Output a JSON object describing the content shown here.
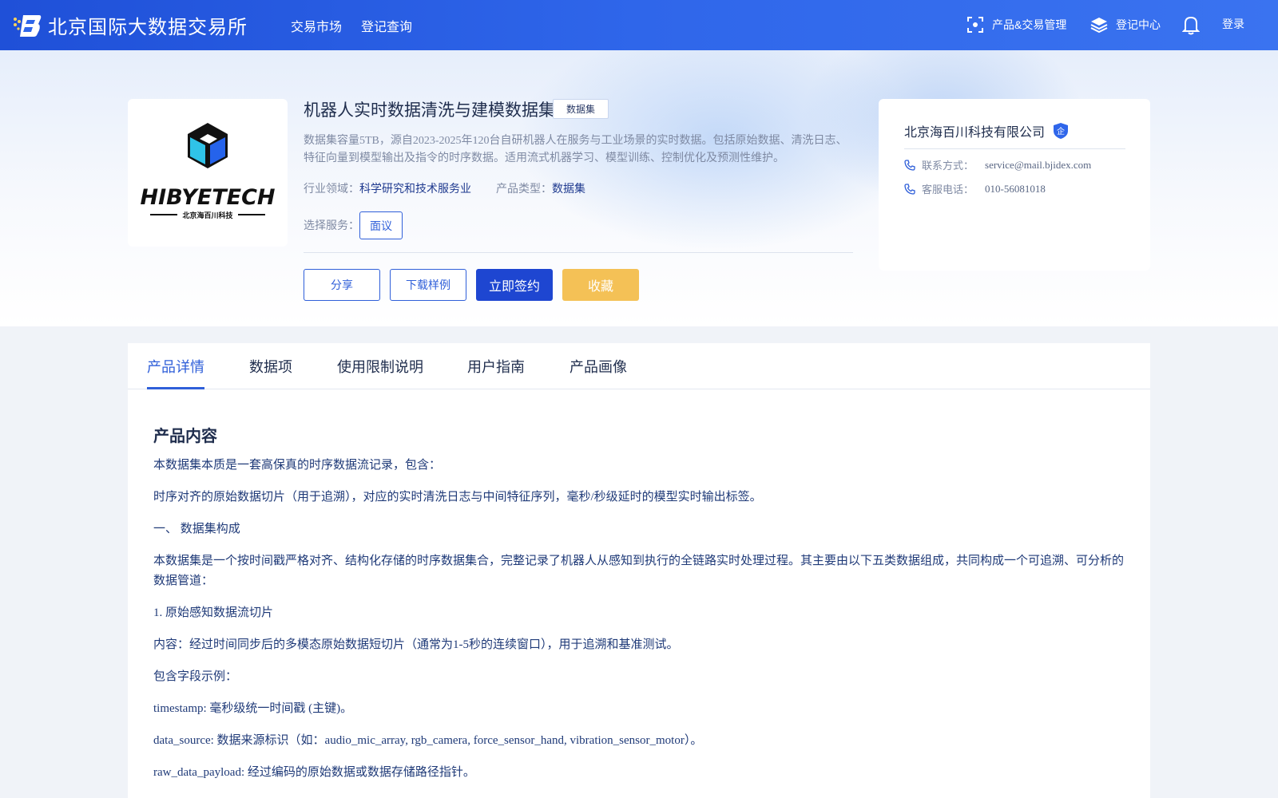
{
  "header": {
    "brand": "北京国际大数据交易所",
    "nav": [
      "交易市场",
      "登记查询"
    ],
    "product_mgmt": "产品&交易管理",
    "register_center": "登记中心",
    "login": "登录"
  },
  "product": {
    "title": "机器人实时数据清洗与建模数据集",
    "tag": "数据集",
    "description": "数据集容量5TB，源自2023-2025年120台自研机器人在服务与工业场景的实时数据。包括原始数据、清洗日志、特征向量到模型输出及指令的时序数据。适用流式机器学习、模型训练、控制优化及预测性维护。",
    "industry_label": "行业领域：",
    "industry_value": "科学研究和技术服务业",
    "type_label": "产品类型：",
    "type_value": "数据集",
    "service_label": "选择服务：",
    "service_option": "面议",
    "logo_text": "HIBYETECH",
    "logo_subtext": "北京海百川科技"
  },
  "actions": {
    "share": "分享",
    "download": "下载样例",
    "sign": "立即签约",
    "favorite": "收藏"
  },
  "company": {
    "name": "北京海百川科技有限公司",
    "badge": "企",
    "contact_label": "联系方式：",
    "contact_value": "service@mail.bjidex.com",
    "phone_label": "客服电话：",
    "phone_value": "010-56081018"
  },
  "tabs": [
    "产品详情",
    "数据项",
    "使用限制说明",
    "用户指南",
    "产品画像"
  ],
  "content": {
    "heading": "产品内容",
    "paragraphs": [
      "本数据集本质是一套高保真的时序数据流记录，包含：",
      "时序对齐的原始数据切片（用于追溯），对应的实时清洗日志与中间特征序列，毫秒/秒级延时的模型实时输出标签。",
      "一、 数据集构成",
      "本数据集是一个按时间戳严格对齐、结构化存储的时序数据集合，完整记录了机器人从感知到执行的全链路实时处理过程。其主要由以下五类数据组成，共同构成一个可追溯、可分析的数据管道：",
      "1. 原始感知数据流切片",
      "内容：经过时间同步后的多模态原始数据短切片（通常为1-5秒的连续窗口），用于追溯和基准测试。",
      "包含字段示例：",
      "timestamp: 毫秒级统一时间戳 (主键)。",
      "data_source: 数据来源标识（如：audio_mic_array, rgb_camera, force_sensor_hand, vibration_sensor_motor）。",
      "raw_data_payload: 经过编码的原始数据或数据存储路径指针。"
    ]
  },
  "colors": {
    "primary": "#2f5fd9",
    "header_start": "#1f50d8",
    "sign_button": "#1e46d1",
    "favorite_button": "#f4c156"
  }
}
